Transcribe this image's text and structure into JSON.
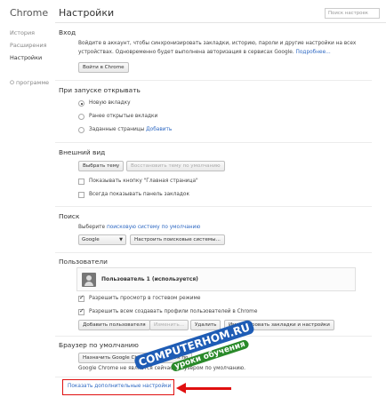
{
  "sidebar": {
    "brand": "Chrome",
    "items": [
      "История",
      "Расширения",
      "Настройки",
      "О программе"
    ]
  },
  "header": {
    "title": "Настройки",
    "search_placeholder": "Поиск настроек"
  },
  "signin": {
    "title": "Вход",
    "text1": "Войдите в аккаунт, чтобы синхронизировать закладки, историю, пароли и другие настройки на всех",
    "text2": "устройствах. Одновременно будет выполнена авторизация в сервисах Google.",
    "more_link": "Подробнее...",
    "button": "Войти в Chrome"
  },
  "startup": {
    "title": "При запуске открывать",
    "options": [
      "Новую вкладку",
      "Ранее открытые вкладки",
      "Заданные страницы"
    ],
    "add_link": "Добавить"
  },
  "appearance": {
    "title": "Внешний вид",
    "theme_button": "Выбрать тему",
    "reset_button": "Восстановить тему по умолчанию",
    "home_button_label": "Показывать кнопку \"Главная страница\"",
    "bookmarks_bar_label": "Всегда показывать панель закладок"
  },
  "search": {
    "title": "Поиск",
    "text": "Выберите",
    "link": "поисковую систему по умолчанию",
    "engine": "Google",
    "manage_button": "Настроить поисковые системы..."
  },
  "users": {
    "title": "Пользователи",
    "current_user": "Пользователь 1 (используется)",
    "guest_label": "Разрешить просмотр в гостевом режиме",
    "profiles_label": "Разрешить всем создавать профили пользователей в Chrome",
    "add_button": "Добавить пользователя",
    "edit_button": "Изменить...",
    "delete_button": "Удалить",
    "import_button": "Импортировать закладки и настройки"
  },
  "default_browser": {
    "title": "Браузер по умолчанию",
    "button": "Назначить Google Chrome браузером по",
    "status": "Google Chrome не является сейчас браузером по умолчанию."
  },
  "advanced": {
    "link": "Показать дополнительные настройки"
  },
  "watermark": {
    "line1": "COMPUTERHOM.RU",
    "line2": "уроки обучения"
  },
  "colors": {
    "link": "#2f69c3",
    "highlight": "#e01010"
  }
}
